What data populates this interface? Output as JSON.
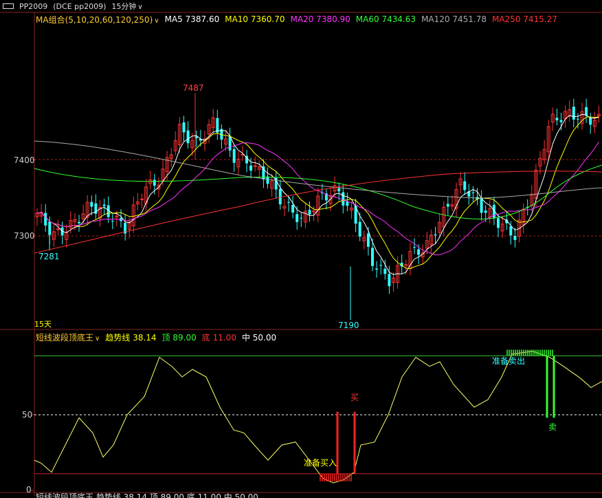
{
  "window": {
    "symbol": "PP2009",
    "exchange_code": "(DCE pp2009)",
    "period": "15分钟"
  },
  "ma_legend": {
    "group_label": "MA组合(5,10,20,60,120,250)",
    "items": [
      {
        "label": "MA5 7387.60",
        "color": "#ffffff"
      },
      {
        "label": "MA10 7360.70",
        "color": "#ffff00"
      },
      {
        "label": "MA20 7380.90",
        "color": "#ff33ff"
      },
      {
        "label": "MA60 7434.63",
        "color": "#33ff33"
      },
      {
        "label": "MA120 7451.78",
        "color": "#aaaaaa"
      },
      {
        "label": "MA250 7415.27",
        "color": "#ff3333"
      }
    ]
  },
  "price_axis": {
    "labels": [
      "7400",
      "7300"
    ]
  },
  "price_marks": {
    "high": "7487",
    "low_left": "7281",
    "low_mid": "7190"
  },
  "period_tag": "15天",
  "indicator": {
    "name": "短线波段顶底王",
    "trend_label": "趋势线",
    "trend_value": "38.14",
    "top_label": "顶",
    "top_value": "89.00",
    "bottom_label": "底",
    "bottom_value": "11.00",
    "mid_label": "中",
    "mid_value": "50.00",
    "axis_labels": [
      "50",
      "0"
    ],
    "signals": {
      "ready_buy": "准备买入",
      "buy": "买",
      "ready_sell": "准备卖出",
      "sell": "卖"
    }
  },
  "bottom_strip": {
    "text": "短线波段顶底王  趋势线 38.14  顶 89.00  底 11.00  中 50.00"
  },
  "colors": {
    "up": "#ff3333",
    "down": "#33ffff",
    "grid": "#882222",
    "top_line": "#33cc33",
    "bottom_line": "#cc2222"
  }
}
